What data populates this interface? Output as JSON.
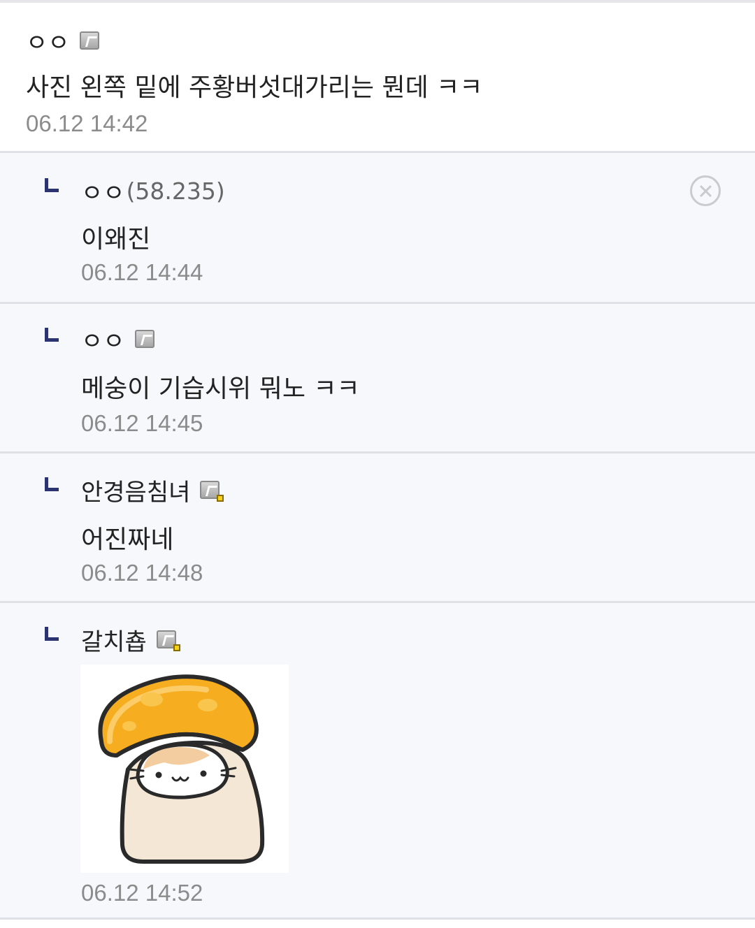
{
  "comments": [
    {
      "nick": "ㅇㅇ",
      "text": "사진 왼쪽 밑에 주황버섯대가리는 뭔데 ㅋㅋ",
      "date": "06.12 14:42"
    }
  ],
  "replies": [
    {
      "nick": "ㅇㅇ",
      "ip": "(58.235)",
      "text": "이왜진",
      "date": "06.12 14:44"
    },
    {
      "nick": "ㅇㅇ",
      "text": "메숭이 기습시위 뭐노 ㅋㅋ",
      "date": "06.12 14:45"
    },
    {
      "nick": "안경음침녀",
      "text": "어진짜네",
      "date": "06.12 14:48"
    },
    {
      "nick": "갈치춉",
      "sticker": "orange-mushroom-cat-sticker",
      "date": "06.12 14:52"
    }
  ],
  "colors": {
    "reply_bg": "#f7f8fb",
    "divider": "#dfe1e6",
    "reply_arrow": "#2b3470",
    "date": "#8b8b8b"
  },
  "icons": [
    "fixed-nick-badge-icon",
    "fixed-nick-badge-manager-icon",
    "reply-arrow-icon",
    "delete-circle-icon"
  ]
}
